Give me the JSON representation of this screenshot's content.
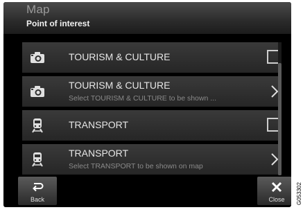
{
  "header": {
    "app_title": "Map",
    "page_title": "Point of interest"
  },
  "list": {
    "items": [
      {
        "icon": "camera-icon",
        "label": "TOURISM & CULTURE",
        "sublabel": "",
        "control": "checkbox",
        "checked": false
      },
      {
        "icon": "camera-icon",
        "label": "TOURISM & CULTURE",
        "sublabel": "Select TOURISM & CULTURE to be shown ...",
        "control": "chevron"
      },
      {
        "icon": "train-icon",
        "label": "TRANSPORT",
        "sublabel": "",
        "control": "checkbox",
        "checked": false
      },
      {
        "icon": "train-icon",
        "label": "TRANSPORT",
        "sublabel": "Select TRANSPORT to be shown on map",
        "control": "chevron"
      }
    ]
  },
  "footer": {
    "back_label": "Back",
    "close_label": "Close"
  },
  "reference_code": "G053302",
  "colors": {
    "screen_background": "#000000",
    "row_background": "#303030",
    "text_primary": "#e6e6e6",
    "text_secondary": "#8a8a8a"
  }
}
